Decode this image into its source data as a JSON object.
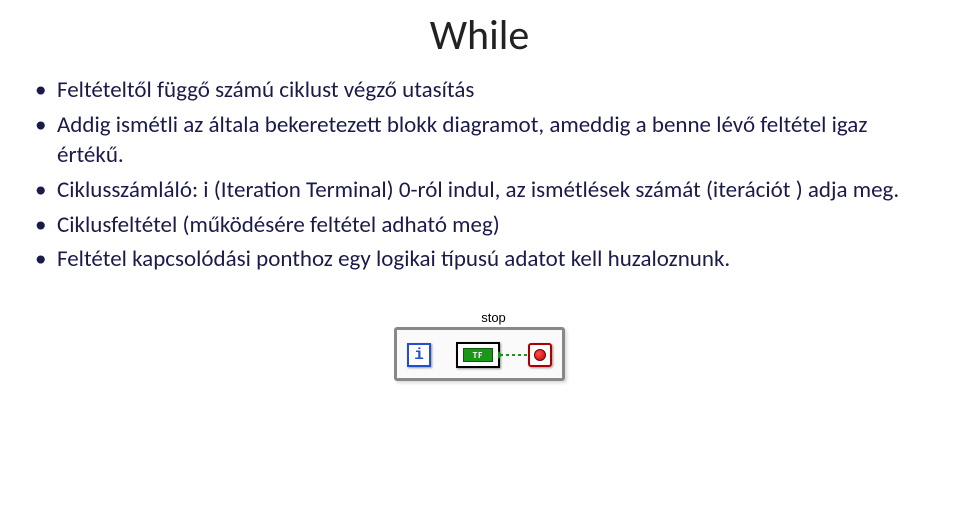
{
  "title": "While",
  "bullets": [
    "Feltételtől függő számú ciklust végző utasítás",
    "Addig ismétli az általa bekeretezett blokk diagramot, ameddig a benne lévő feltétel igaz értékű.",
    "Ciklusszámláló: i (Iteration Terminal) 0-ról indul, az ismétlések számát (iterációt ) adja meg.",
    "Ciklusfeltétel (működésére feltétel adható meg)",
    "Feltétel kapcsolódási ponthoz egy logikai típusú adatot kell huzaloznunk."
  ],
  "diagram": {
    "stop_label": "stop",
    "iteration_symbol": "i",
    "bool_text": "TF"
  }
}
